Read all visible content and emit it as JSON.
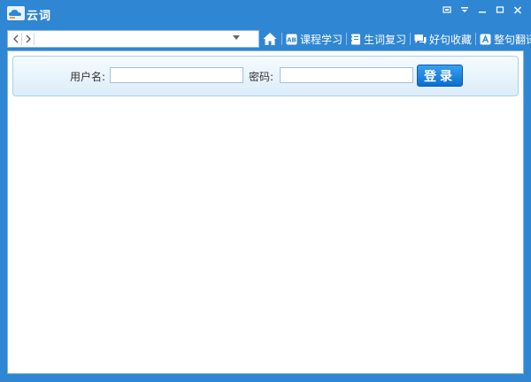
{
  "app": {
    "title": "云词"
  },
  "window_buttons": [
    "skin-icon",
    "menu-icon",
    "minimize-icon",
    "maximize-icon",
    "close-icon"
  ],
  "address": {
    "value": "",
    "placeholder": ""
  },
  "menus": [
    {
      "label": "课程学习",
      "icon": "ab-icon"
    },
    {
      "label": "生词复习",
      "icon": "notebook-icon"
    },
    {
      "label": "好句收藏",
      "icon": "chat-icon"
    },
    {
      "label": "整句翻译",
      "icon": "translate-icon"
    }
  ],
  "login": {
    "username_label": "用户名:",
    "password_label": "密码:",
    "username_value": "",
    "password_value": "",
    "button_label": "登录"
  },
  "colors": {
    "frame": "#2f86d2",
    "login_button": "#0a6fd0"
  }
}
